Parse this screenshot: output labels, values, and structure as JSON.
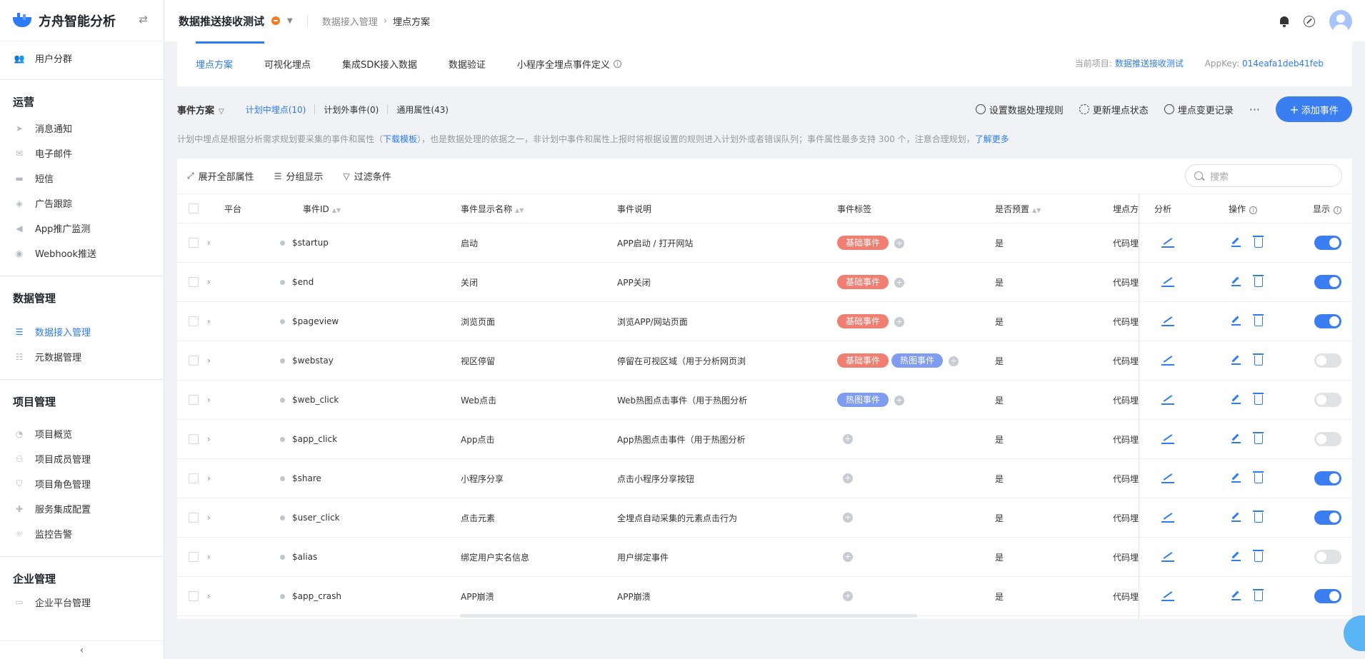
{
  "brand": {
    "name": "方舟智能分析"
  },
  "sidebar": {
    "top_item": "用户分群",
    "groups": [
      {
        "title": "运营",
        "items": [
          "消息通知",
          "电子邮件",
          "短信",
          "广告跟踪",
          "App推广监测",
          "Webhook推送"
        ]
      },
      {
        "title": "数据管理",
        "items": [
          "数据接入管理",
          "元数据管理"
        ]
      },
      {
        "title": "项目管理",
        "items": [
          "项目概览",
          "项目成员管理",
          "项目角色管理",
          "服务集成配置",
          "监控告警"
        ]
      },
      {
        "title": "企业管理",
        "items": [
          "企业平台管理"
        ]
      }
    ],
    "collapse": "‹"
  },
  "header": {
    "project": "数据推送接收测试",
    "breadcrumb": [
      "数据接入管理",
      "埋点方案"
    ]
  },
  "tabs": [
    "埋点方案",
    "可视化埋点",
    "集成SDK接入数据",
    "数据验证",
    "小程序全埋点事件定义"
  ],
  "project_info": {
    "label": "当前项目:",
    "project": "数据推送接收测试",
    "appkey_label": "AppKey:",
    "appkey": "014eafa1deb41feb"
  },
  "toolbar": {
    "scheme": "事件方案",
    "subtabs": [
      "计划中埋点(10)",
      "计划外事件(0)",
      "通用属性(43)"
    ],
    "actions": [
      "设置数据处理规则",
      "更新埋点状态",
      "埋点变更记录"
    ],
    "more": "···",
    "add": "添加事件"
  },
  "notice": {
    "pre": "计划中埋点是根据分析需求规划要采集的事件和属性（",
    "link1": "下载模板",
    "mid": "），也是数据处理的依据之一，非计划中事件和属性上报时将根据设置的规则进入计划外或者错误队列；事件属性最多支持 300 个，注意合理规划，",
    "link2": "了解更多"
  },
  "panel_tools": [
    "展开全部属性",
    "分组显示",
    "过滤条件"
  ],
  "search": {
    "placeholder": "搜索"
  },
  "columns": {
    "platform": "平台",
    "event_id": "事件ID",
    "display_name": "事件显示名称",
    "desc": "事件说明",
    "tags": "事件标签",
    "preset": "是否预置",
    "scheme": "埋点方",
    "analysis": "分析",
    "ops": "操作",
    "show": "显示"
  },
  "rows": [
    {
      "id": "$startup",
      "name": "启动",
      "desc": "APP启动 / 打开网站",
      "preset": "是",
      "scheme": "代码埋"
    },
    {
      "id": "$end",
      "name": "关闭",
      "desc": "APP关闭",
      "preset": "是",
      "scheme": "代码埋"
    },
    {
      "id": "$pageview",
      "name": "浏览页面",
      "desc": "浏览APP/网站页面",
      "preset": "是",
      "scheme": "代码埋"
    },
    {
      "id": "$webstay",
      "name": "视区停留",
      "desc": "停留在可视区域（用于分析网页浏",
      "preset": "是",
      "scheme": "代码埋"
    },
    {
      "id": "$web_click",
      "name": "Web点击",
      "desc": "Web热图点击事件（用于热图分析",
      "preset": "是",
      "scheme": "代码埋"
    },
    {
      "id": "$app_click",
      "name": "App点击",
      "desc": "App热图点击事件（用于热图分析",
      "preset": "是",
      "scheme": "代码埋"
    },
    {
      "id": "$share",
      "name": "小程序分享",
      "desc": "点击小程序分享按钮",
      "preset": "是",
      "scheme": "代码埋"
    },
    {
      "id": "$user_click",
      "name": "点击元素",
      "desc": "全埋点自动采集的元素点击行为",
      "preset": "是",
      "scheme": "代码埋"
    },
    {
      "id": "$alias",
      "name": "绑定用户实名信息",
      "desc": "用户绑定事件",
      "preset": "是",
      "scheme": "代码埋"
    },
    {
      "id": "$app_crash",
      "name": "APP崩溃",
      "desc": "APP崩溃",
      "preset": "是",
      "scheme": "代码埋"
    }
  ],
  "tag_labels": {
    "basic": "基础事件",
    "heat": "热图事件"
  },
  "row_tags": [
    [
      "basic"
    ],
    [
      "basic"
    ],
    [
      "basic"
    ],
    [
      "basic",
      "heat"
    ],
    [
      "heat"
    ],
    [],
    [],
    [],
    [],
    []
  ],
  "row_show": [
    true,
    true,
    true,
    false,
    false,
    false,
    true,
    true,
    false,
    true
  ],
  "colors": {
    "accent": "#2d7cf6",
    "basic_tag": "#f07f72",
    "heat_tag": "#7f9cf1",
    "toggle_on": "#3a7ef2"
  }
}
